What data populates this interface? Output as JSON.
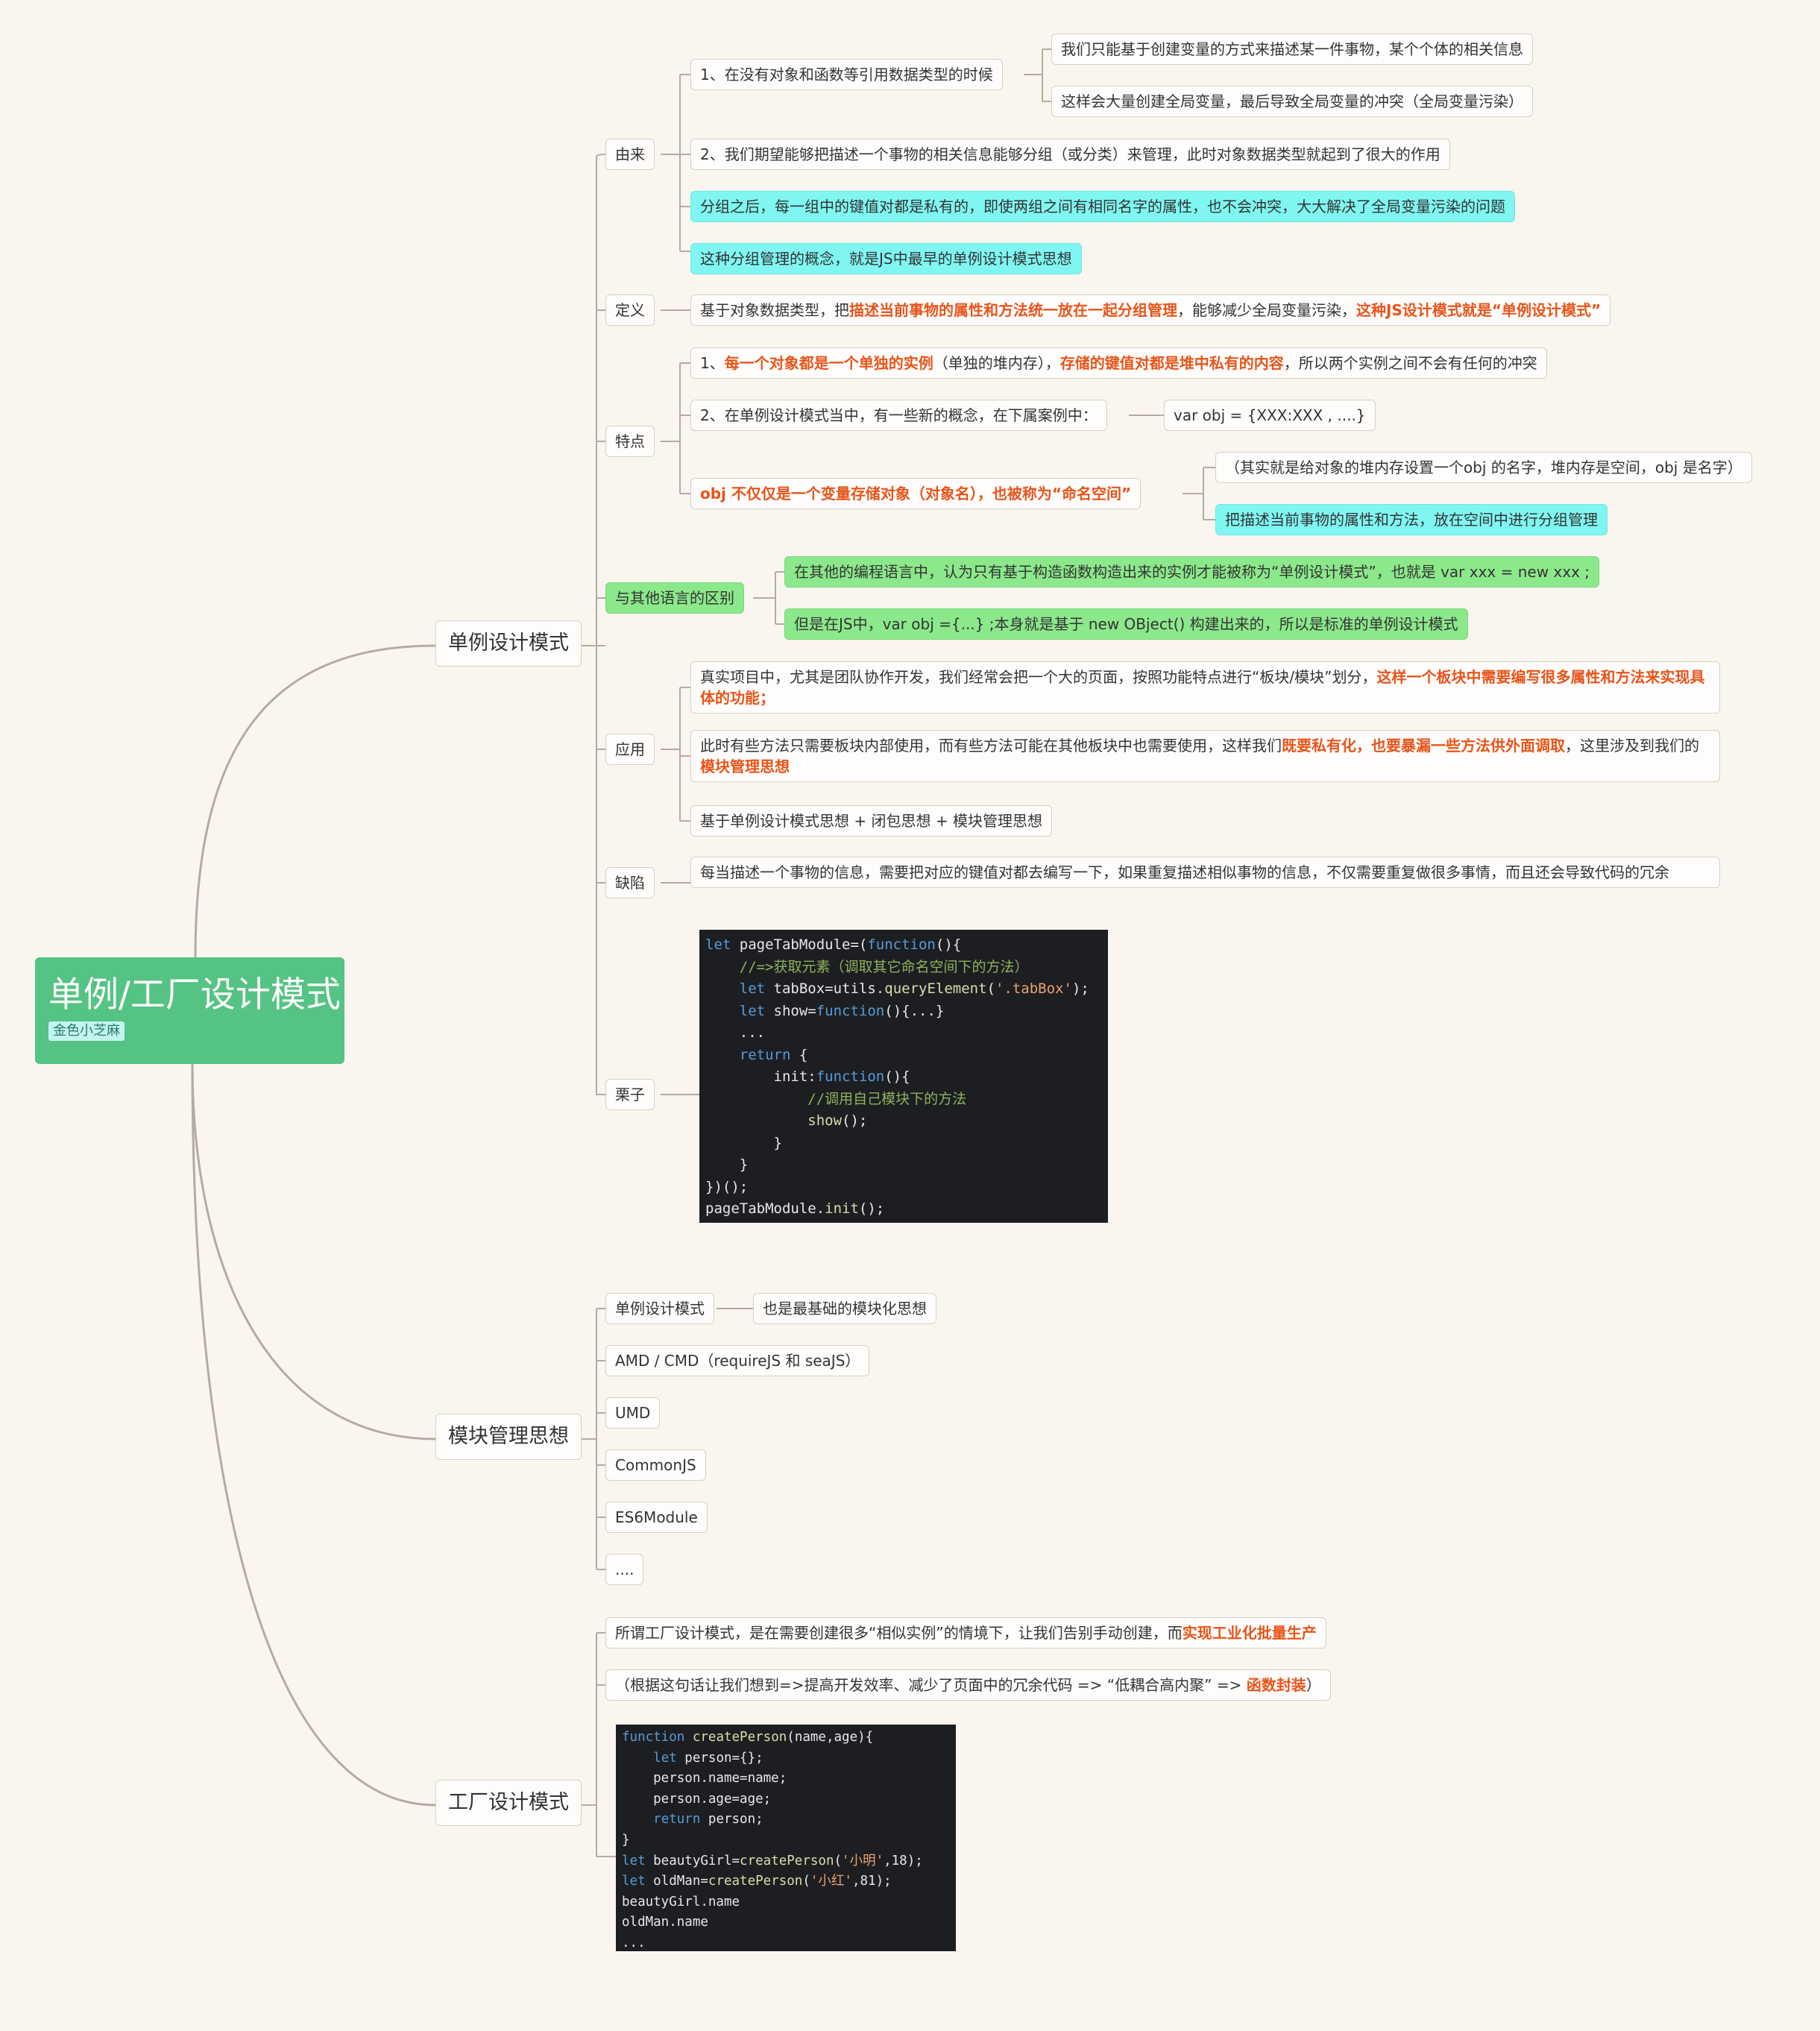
{
  "root": {
    "title": "单例/工厂设计模式",
    "tag": "金色小芝麻"
  },
  "branches": {
    "singleton": "单例设计模式",
    "module": "模块管理思想",
    "factory": "工厂设计模式"
  },
  "singleton": {
    "origin": {
      "label": "由来",
      "item1": "1、在没有对象和函数等引用数据类型的时候",
      "item1_sub1": "我们只能基于创建变量的方式来描述某一件事物，某个个体的相关信息",
      "item1_sub2": "这样会大量创建全局变量，最后导致全局变量的冲突（全局变量污染）",
      "item2": "2、我们期望能够把描述一个事物的相关信息能够分组（或分类）来管理，此时对象数据类型就起到了很大的作用",
      "item3": "分组之后，每一组中的键值对都是私有的，即使两组之间有相同名字的属性，也不会冲突，大大解决了全局变量污染的问题",
      "item4": "这种分组管理的概念，就是JS中最早的单例设计模式思想"
    },
    "definition": {
      "label": "定义",
      "t1": "基于对象数据类型，把",
      "h1": "描述当前事物的属性和方法统一放在一起分组管理",
      "t2": "，能够减少全局变量污染，",
      "h2": "这种JS设计模式就是“单例设计模式”"
    },
    "features": {
      "label": "特点",
      "f1_t1": "1、",
      "f1_h1": "每一个对象都是一个单独的实例",
      "f1_t2": "（单独的堆内存），",
      "f1_h2": "存储的键值对都是堆中私有的内容",
      "f1_t3": "，所以两个实例之间不会有任何的冲突",
      "f2": "2、在单例设计模式当中，有一些新的概念，在下属案例中：",
      "f2_sub": "var obj = {XXX:XXX , ....}",
      "f3": "obj 不仅仅是一个变量存储对象（对象名），也被称为“命名空间”",
      "f3_sub1": "（其实就是给对象的堆内存设置一个obj 的名字，堆内存是空间，obj 是名字）",
      "f3_sub2": "把描述当前事物的属性和方法，放在空间中进行分组管理"
    },
    "diff": {
      "label": "与其他语言的区别",
      "d1": "在其他的编程语言中，认为只有基于构造函数构造出来的实例才能被称为“单例设计模式”，也就是 var xxx = new xxx ;",
      "d2": "但是在JS中，var obj ={...} ;本身就是基于 new OBject() 构建出来的，所以是标准的单例设计模式"
    },
    "usage": {
      "label": "应用",
      "u1_t1": "真实项目中，尤其是团队协作开发，我们经常会把一个大的页面，按照功能特点进行“板块/模块”划分，",
      "u1_h1": "这样一个板块中需要编写很多属性和方法来实现具体的功能；",
      "u2_t1": "此时有些方法只需要板块内部使用，而有些方法可能在其他板块中也需要使用，这样我们",
      "u2_h1": "既要私有化，也要暴漏一些方法供外面调取",
      "u2_t2": "，这里涉及到我们的",
      "u2_h2": "模块管理思想",
      "u3": "基于单例设计模式思想 + 闭包思想 + 模块管理思想"
    },
    "defect": {
      "label": "缺陷",
      "text": "每当描述一个事物的信息，需要把对应的键值对都去编写一下，如果重复描述相似事物的信息，不仅需要重复做很多事情，而且还会导致代码的冗余"
    },
    "example": {
      "label": "栗子",
      "code": [
        "let pageTabModule=(function(){",
        "    //=>获取元素（调取其它命名空间下的方法）",
        "    let tabBox=utils.queryElement('.tabBox');",
        "    let show=function(){...}",
        "    ...",
        "    return {",
        "        init:function(){",
        "            //调用自己模块下的方法",
        "            show();",
        "        }",
        "    }",
        "})();",
        "pageTabModule.init();"
      ]
    }
  },
  "module": {
    "m1": "单例设计模式",
    "m1_sub": "也是最基础的模块化思想",
    "m2": "AMD / CMD（requireJS 和 seaJS）",
    "m3": "UMD",
    "m4": "CommonJS",
    "m5": "ES6Module",
    "m6": "...."
  },
  "factory": {
    "p1_t1": "所谓工厂设计模式，是在需要创建很多“相似实例”的情境下，让我们告别手动创建，而",
    "p1_h1": "实现工业化批量生产",
    "p2_t1": "（根据这句话让我们想到=>提高开发效率、减少了页面中的冗余代码 =>  “低耦合高内聚”  => ",
    "p2_h1": "函数封装",
    "p2_t2": "）",
    "code": [
      "function createPerson(name,age){",
      "    let person={};",
      "    person.name=name;",
      "    person.age=age;",
      "    return person;",
      "}",
      "let beautyGirl=createPerson('小明',18);",
      "let oldMan=createPerson('小红',81);",
      "beautyGirl.name",
      "oldMan.name",
      "..."
    ]
  },
  "colors": {
    "background": "#fbf5ef",
    "root": "#55c383",
    "highlight": "#e8541a",
    "cyan": "#7ff6f2",
    "green": "#8be88b",
    "code_bg": "#1d1e22"
  }
}
